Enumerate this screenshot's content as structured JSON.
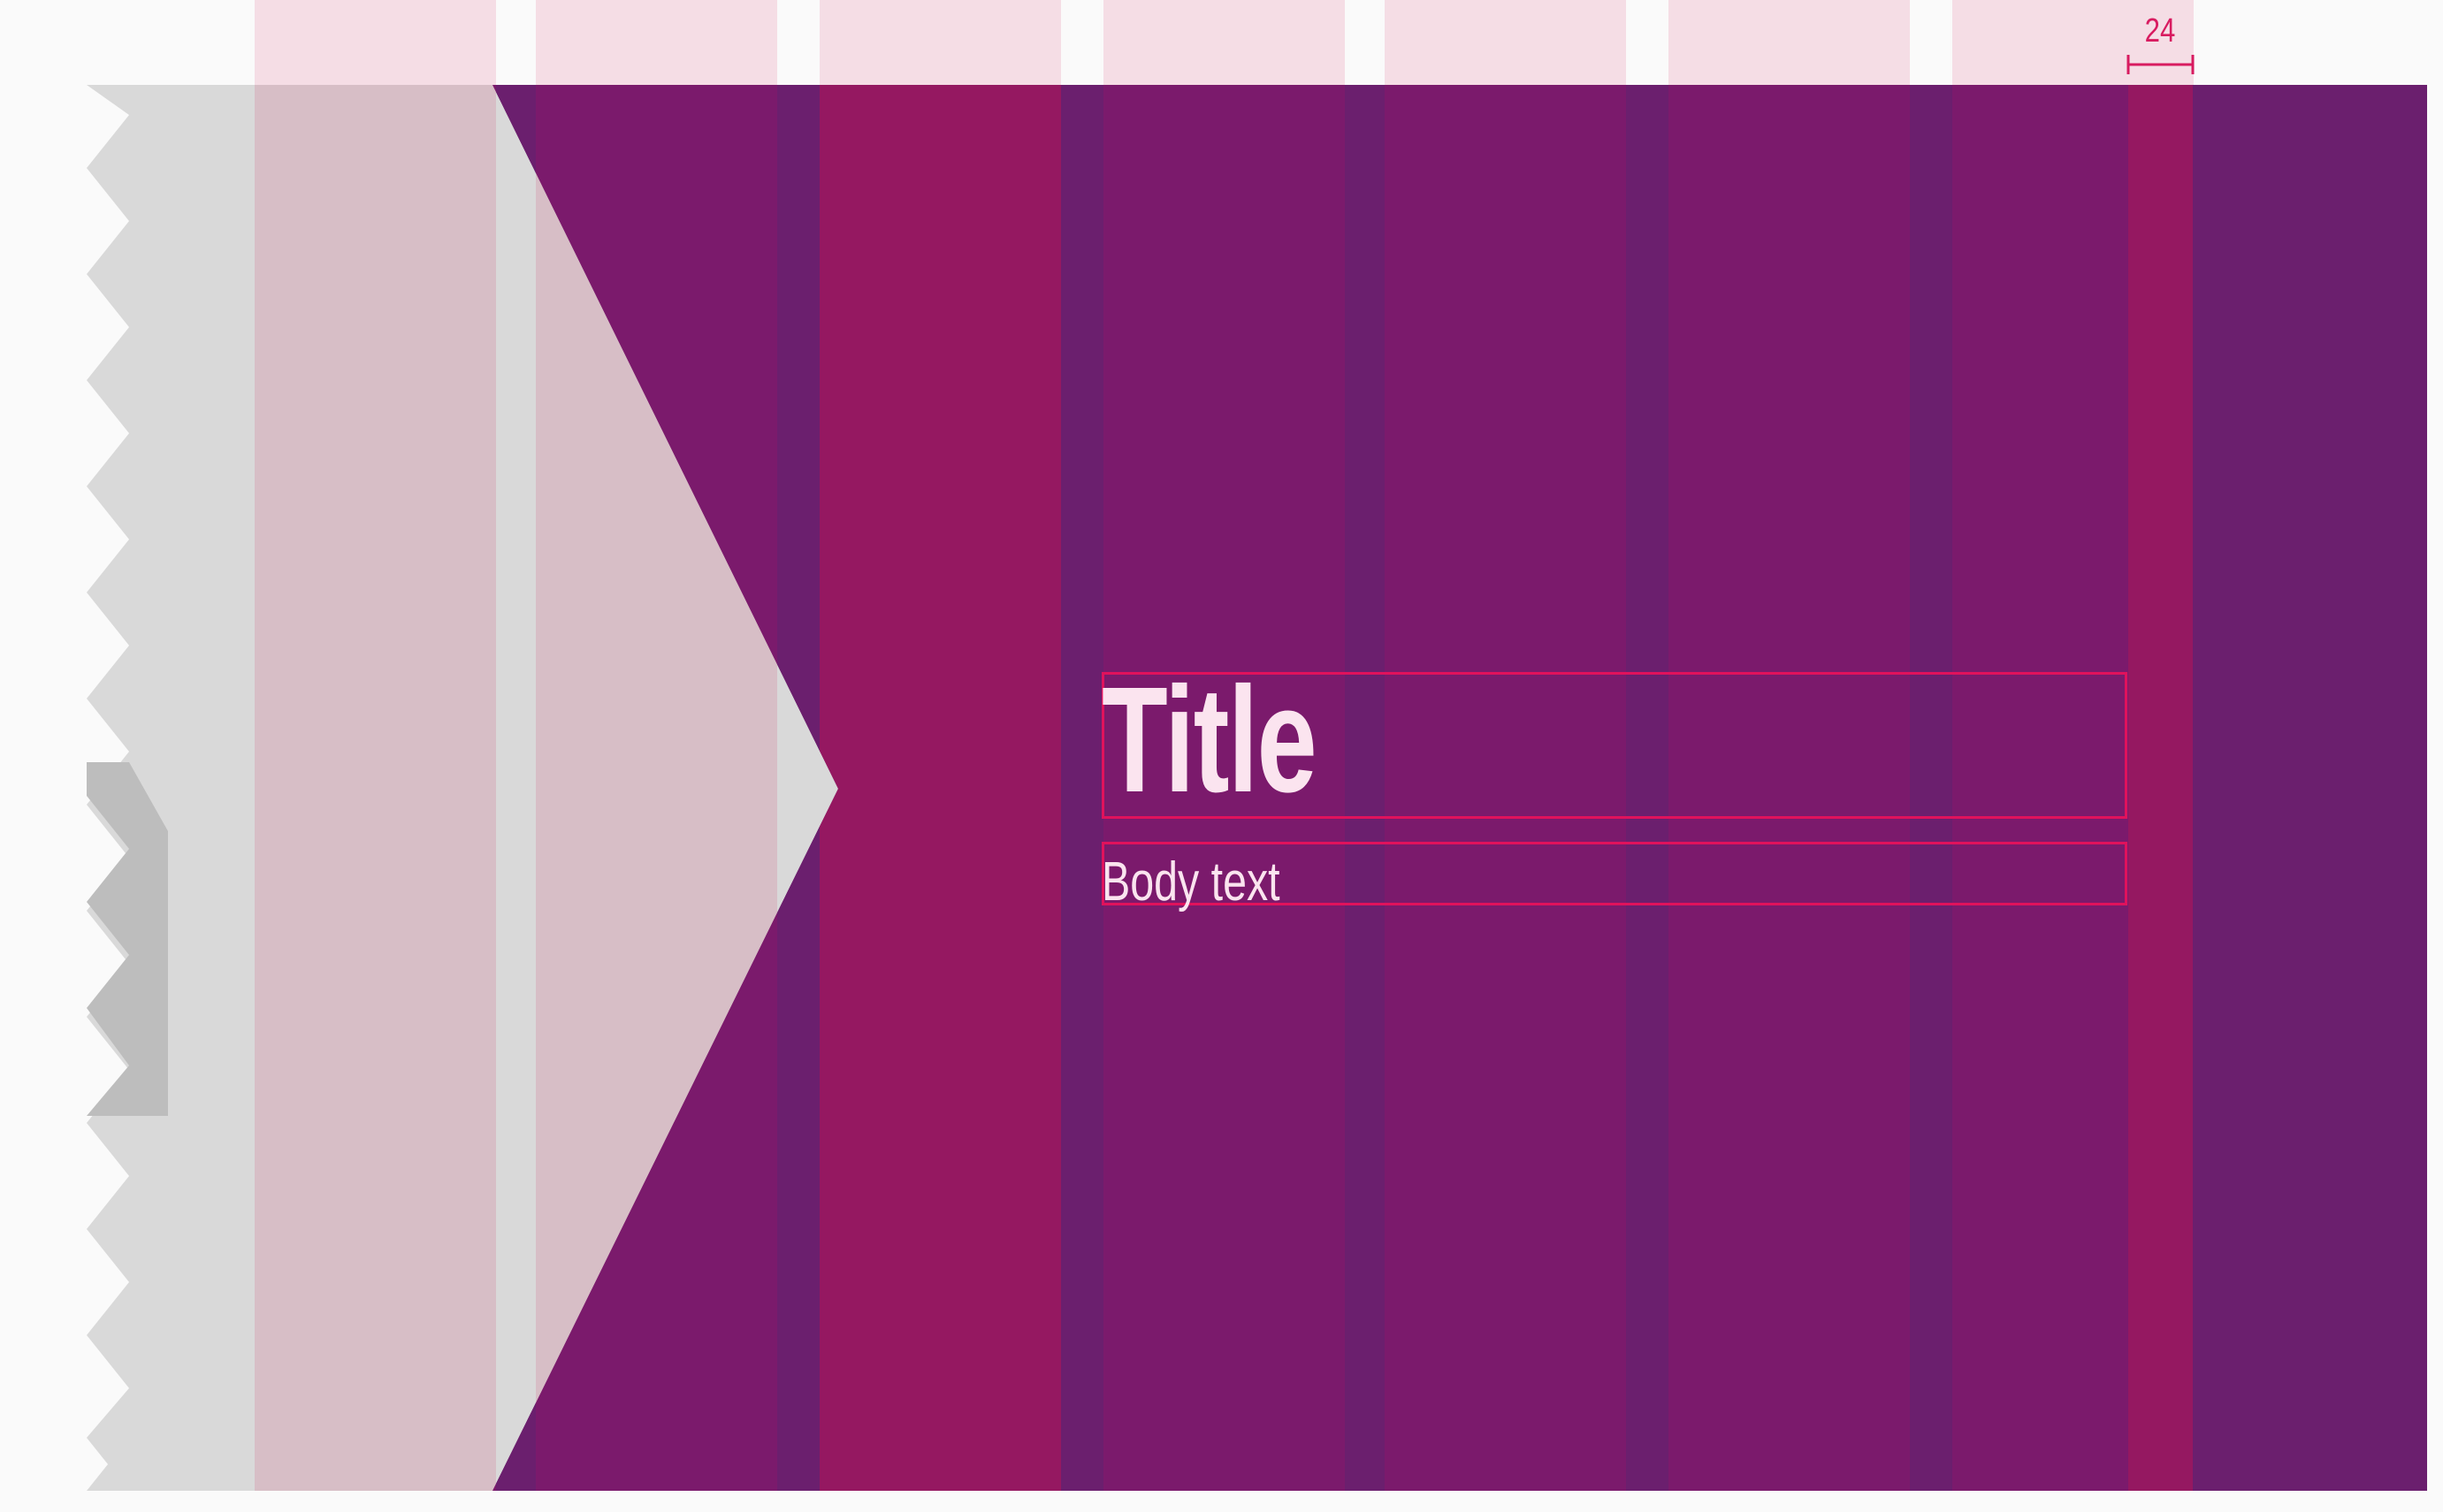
{
  "diagram": {
    "spacing_measure_label": "24",
    "title_placeholder": "Title",
    "body_placeholder": "Body text"
  },
  "colors": {
    "page_background": "#fafafa",
    "column_guide_pink": "#f5dde5",
    "dark_purple_panel": "#7b1a6c",
    "gutter_purple": "#6b1f6e",
    "highlight_magenta_column": "#951861",
    "gray_panel": "#d9d9d9",
    "pink_overlay_on_gray": "#d7bec6",
    "text_box_outline": "#e0125c",
    "text_light_pink": "#fbe4ef"
  }
}
